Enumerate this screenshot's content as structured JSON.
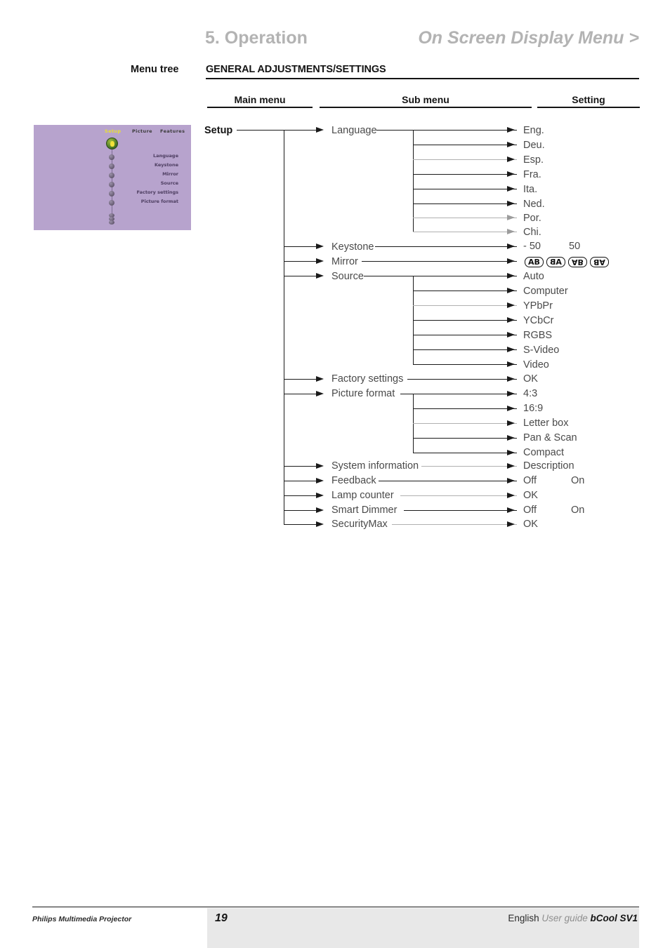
{
  "header": {
    "chapter": "5. Operation",
    "section": "On Screen Display Menu >",
    "menu_tree_label": "Menu tree",
    "general_title": "GENERAL ADJUSTMENTS/SETTINGS"
  },
  "columns": {
    "main_menu": "Main menu",
    "sub_menu": "Sub menu",
    "setting": "Setting"
  },
  "osd": {
    "tabs": [
      {
        "label": "Setup",
        "active": true
      },
      {
        "label": "Picture",
        "active": false
      },
      {
        "label": "Features",
        "active": false
      }
    ],
    "items": [
      "Language",
      "Keystone",
      "Mirror",
      "Source",
      "Factory settings",
      "Picture format"
    ],
    "background_color": "#b7a3cd",
    "active_tab_color": "#e9e032"
  },
  "tree": {
    "root": "Setup",
    "branches": [
      {
        "label": "Language",
        "settings": [
          "Eng.",
          "Deu.",
          "Esp.",
          "Fra.",
          "Ita.",
          "Ned.",
          "Por.",
          "Chi."
        ]
      },
      {
        "label": "Keystone",
        "settings": [
          "- 50"
        ],
        "setting_right": "50"
      },
      {
        "label": "Mirror",
        "mirror_glyphs": [
          "AB",
          "AB",
          "AB",
          "AB"
        ]
      },
      {
        "label": "Source",
        "settings": [
          "Auto",
          "Computer",
          "YPbPr",
          "YCbCr",
          "RGBS",
          "S-Video",
          "Video"
        ]
      },
      {
        "label": "Factory settings",
        "settings": [
          "OK"
        ]
      },
      {
        "label": "Picture format",
        "settings": [
          "4:3",
          "16:9",
          "Letter box",
          "Pan & Scan",
          "Compact"
        ]
      },
      {
        "label": "System information",
        "settings": [
          "Description"
        ]
      },
      {
        "label": "Feedback",
        "settings": [
          "Off"
        ],
        "setting_right": "On"
      },
      {
        "label": "Lamp counter",
        "settings": [
          "OK"
        ]
      },
      {
        "label": "Smart Dimmer",
        "settings": [
          "Off"
        ],
        "setting_right": "On"
      },
      {
        "label": "SecurityMax",
        "settings": [
          "OK"
        ]
      }
    ]
  },
  "footer": {
    "brand": "Philips Multimedia Projector",
    "page_number": "19",
    "language": "English",
    "doc_type": "User guide",
    "model": "bCool SV1"
  }
}
